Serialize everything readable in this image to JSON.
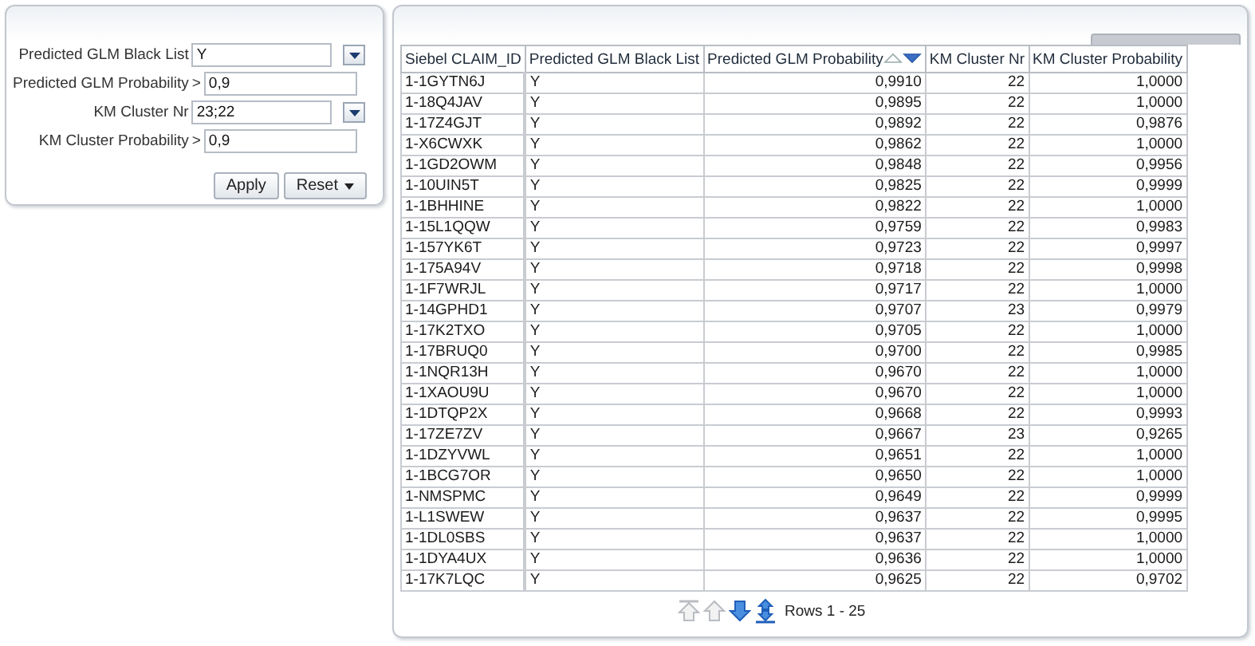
{
  "filters": [
    {
      "label": "Predicted GLM Black List",
      "kind": "select",
      "value": "Y"
    },
    {
      "label": "Predicted GLM Probability",
      "kind": "text",
      "operator": ">",
      "value": "0,9"
    },
    {
      "label": "KM Cluster Nr",
      "kind": "select",
      "value": "23;22"
    },
    {
      "label": "KM Cluster Probability",
      "kind": "text",
      "operator": ">",
      "value": "0,9"
    }
  ],
  "buttons": [
    {
      "label": "Apply",
      "kind": "plain"
    },
    {
      "label": "Reset",
      "kind": "menu"
    }
  ],
  "table": {
    "columns": [
      {
        "label": "Siebel CLAIM_ID",
        "sorted": false
      },
      {
        "label": "Predicted GLM Black List",
        "sorted": false
      },
      {
        "label": "Predicted GLM Probability",
        "sorted": true
      },
      {
        "label": "KM Cluster Nr",
        "sorted": false
      },
      {
        "label": "KM Cluster Probability",
        "sorted": false
      }
    ],
    "rows": [
      [
        "1-1GYTN6J",
        "Y",
        "0,9910",
        "22",
        "1,0000"
      ],
      [
        "1-18Q4JAV",
        "Y",
        "0,9895",
        "22",
        "1,0000"
      ],
      [
        "1-17Z4GJT",
        "Y",
        "0,9892",
        "22",
        "0,9876"
      ],
      [
        "1-X6CWXK",
        "Y",
        "0,9862",
        "22",
        "1,0000"
      ],
      [
        "1-1GD2OWM",
        "Y",
        "0,9848",
        "22",
        "0,9956"
      ],
      [
        "1-10UIN5T",
        "Y",
        "0,9825",
        "22",
        "0,9999"
      ],
      [
        "1-1BHHINE",
        "Y",
        "0,9822",
        "22",
        "1,0000"
      ],
      [
        "1-15L1QQW",
        "Y",
        "0,9759",
        "22",
        "0,9983"
      ],
      [
        "1-157YK6T",
        "Y",
        "0,9723",
        "22",
        "0,9997"
      ],
      [
        "1-175A94V",
        "Y",
        "0,9718",
        "22",
        "0,9998"
      ],
      [
        "1-1F7WRJL",
        "Y",
        "0,9717",
        "22",
        "1,0000"
      ],
      [
        "1-14GPHD1",
        "Y",
        "0,9707",
        "23",
        "0,9979"
      ],
      [
        "1-17K2TXO",
        "Y",
        "0,9705",
        "22",
        "1,0000"
      ],
      [
        "1-17BRUQ0",
        "Y",
        "0,9700",
        "22",
        "0,9985"
      ],
      [
        "1-1NQR13H",
        "Y",
        "0,9670",
        "22",
        "1,0000"
      ],
      [
        "1-1XAOU9U",
        "Y",
        "0,9670",
        "22",
        "1,0000"
      ],
      [
        "1-1DTQP2X",
        "Y",
        "0,9668",
        "22",
        "0,9993"
      ],
      [
        "1-17ZE7ZV",
        "Y",
        "0,9667",
        "23",
        "0,9265"
      ],
      [
        "1-1DZYVWL",
        "Y",
        "0,9651",
        "22",
        "1,0000"
      ],
      [
        "1-1BCG7OR",
        "Y",
        "0,9650",
        "22",
        "1,0000"
      ],
      [
        "1-NMSPMC",
        "Y",
        "0,9649",
        "22",
        "0,9999"
      ],
      [
        "1-L1SWEW",
        "Y",
        "0,9637",
        "22",
        "0,9995"
      ],
      [
        "1-1DL0SBS",
        "Y",
        "0,9637",
        "22",
        "1,0000"
      ],
      [
        "1-1DYA4UX",
        "Y",
        "0,9636",
        "22",
        "1,0000"
      ],
      [
        "1-17K7LQC",
        "Y",
        "0,9625",
        "22",
        "0,9702"
      ]
    ]
  },
  "pager": {
    "controls": [
      {
        "kind": "first",
        "disabled": true
      },
      {
        "kind": "previous",
        "disabled": true
      },
      {
        "kind": "next",
        "disabled": false
      },
      {
        "kind": "last",
        "disabled": false
      }
    ],
    "label": "Rows 1 - 25"
  }
}
